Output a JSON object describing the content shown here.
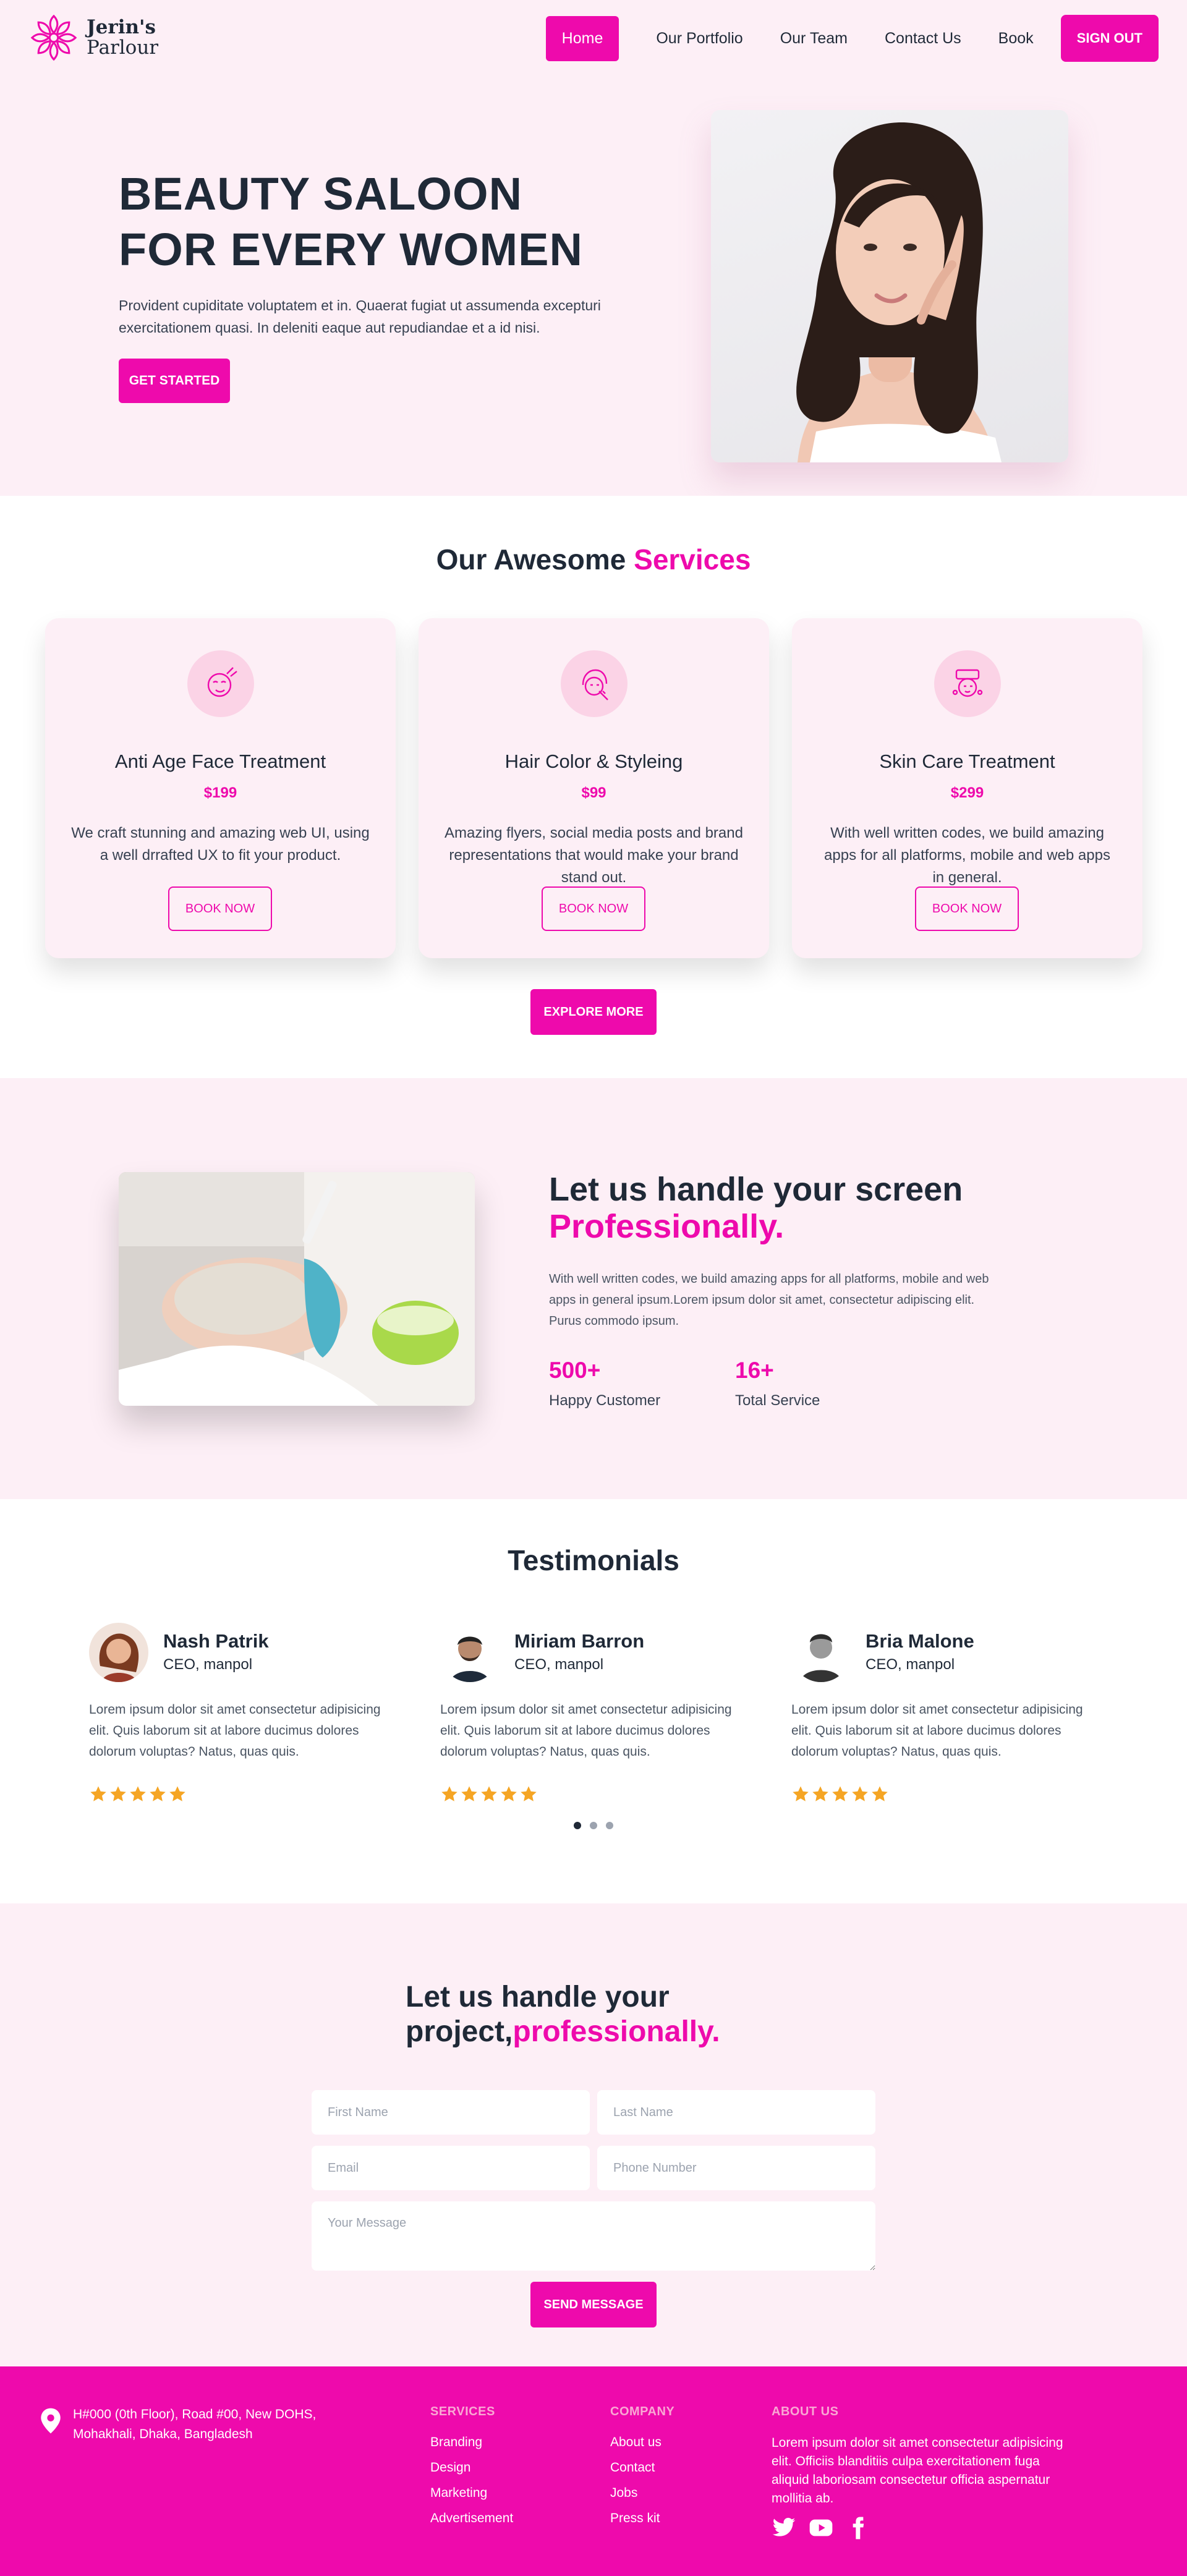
{
  "nav": {
    "brand_line1": "Jerin's",
    "brand_line2": "Parlour",
    "items": [
      {
        "label": "Home"
      },
      {
        "label": "Our Portfolio"
      },
      {
        "label": "Our Team"
      },
      {
        "label": "Contact Us"
      },
      {
        "label": "Book"
      }
    ],
    "signout_label": "SIGN OUT"
  },
  "hero": {
    "title_line1": "BEAUTY SALOON",
    "title_line2": "FOR EVERY WOMEN",
    "description": "Provident cupiditate voluptatem et in. Quaerat fugiat ut assumenda excepturi exercitationem quasi. In deleniti eaque aut repudiandae et a id nisi.",
    "cta_label": "GET STARTED"
  },
  "services": {
    "title_plain": "Our Awesome",
    "title_accent": "Services",
    "cards": [
      {
        "title": "Anti Age Face Treatment",
        "price": "$199",
        "description": "We craft stunning and amazing web UI, using a well drrafted UX to fit your product.",
        "button": "BOOK NOW",
        "icon": "face-treatment-icon"
      },
      {
        "title": "Hair Color & Styleing",
        "price": "$99",
        "description": "Amazing flyers, social media posts and brand representations that would make your brand stand out.",
        "button": "BOOK NOW",
        "icon": "hair-color-icon"
      },
      {
        "title": "Skin Care Treatment",
        "price": "$299",
        "description": "With well written codes, we build amazing apps for all platforms, mobile and web apps in general.",
        "button": "BOOK NOW",
        "icon": "skin-care-icon"
      }
    ],
    "explore_label": "EXPLORE MORE"
  },
  "about": {
    "title_line1": "Let us handle your screen",
    "title_accent": "Professionally.",
    "description": "With well written codes, we build amazing apps for all platforms, mobile and web apps in general ipsum.Lorem ipsum dolor sit amet, consectetur adipiscing elit. Purus commodo ipsum.",
    "stats": [
      {
        "value": "500+",
        "label": "Happy Customer"
      },
      {
        "value": "16+",
        "label": "Total Service"
      }
    ]
  },
  "testimonials": {
    "title": "Testimonials",
    "items": [
      {
        "name": "Nash Patrik",
        "role": "CEO, manpol",
        "text": "Lorem ipsum dolor sit amet consectetur adipisicing elit. Quis laborum sit at labore ducimus dolores dolorum voluptas? Natus, quas quis.",
        "rating": 5
      },
      {
        "name": "Miriam Barron",
        "role": "CEO, manpol",
        "text": "Lorem ipsum dolor sit amet consectetur adipisicing elit. Quis laborum sit at labore ducimus dolores dolorum voluptas? Natus, quas quis.",
        "rating": 5
      },
      {
        "name": "Bria Malone",
        "role": "CEO, manpol",
        "text": "Lorem ipsum dolor sit amet consectetur adipisicing elit. Quis laborum sit at labore ducimus dolores dolorum voluptas? Natus, quas quis.",
        "rating": 5
      }
    ],
    "carousel_active_index": 0,
    "carousel_count": 3
  },
  "contact": {
    "title_line1": "Let us handle your",
    "title_line2_plain": "project,",
    "title_line2_accent": "professionally.",
    "placeholders": {
      "first_name": "First Name",
      "last_name": "Last Name",
      "email": "Email",
      "phone": "Phone Number",
      "message": "Your Message"
    },
    "send_label": "SEND MESSAGE"
  },
  "footer": {
    "address": "H#000 (0th Floor), Road #00, New DOHS, Mohakhali, Dhaka, Bangladesh",
    "services": {
      "heading": "SERVICES",
      "links": [
        "Branding",
        "Design",
        "Marketing",
        "Advertisement"
      ]
    },
    "company": {
      "heading": "COMPANY",
      "links": [
        "About us",
        "Contact",
        "Jobs",
        "Press kit"
      ]
    },
    "about": {
      "heading": "ABOUT US",
      "text": "Lorem ipsum dolor sit amet consectetur adipisicing elit. Officiis blanditiis culpa exercitationem fuga aliquid laboriosam consectetur officia aspernatur mollitia ab."
    },
    "social": [
      "twitter-icon",
      "youtube-icon",
      "facebook-icon"
    ]
  },
  "colors": {
    "accent": "#ee0aac",
    "section_bg": "#fdeff6",
    "text_dark": "#1f2937",
    "star": "#f5a524"
  }
}
